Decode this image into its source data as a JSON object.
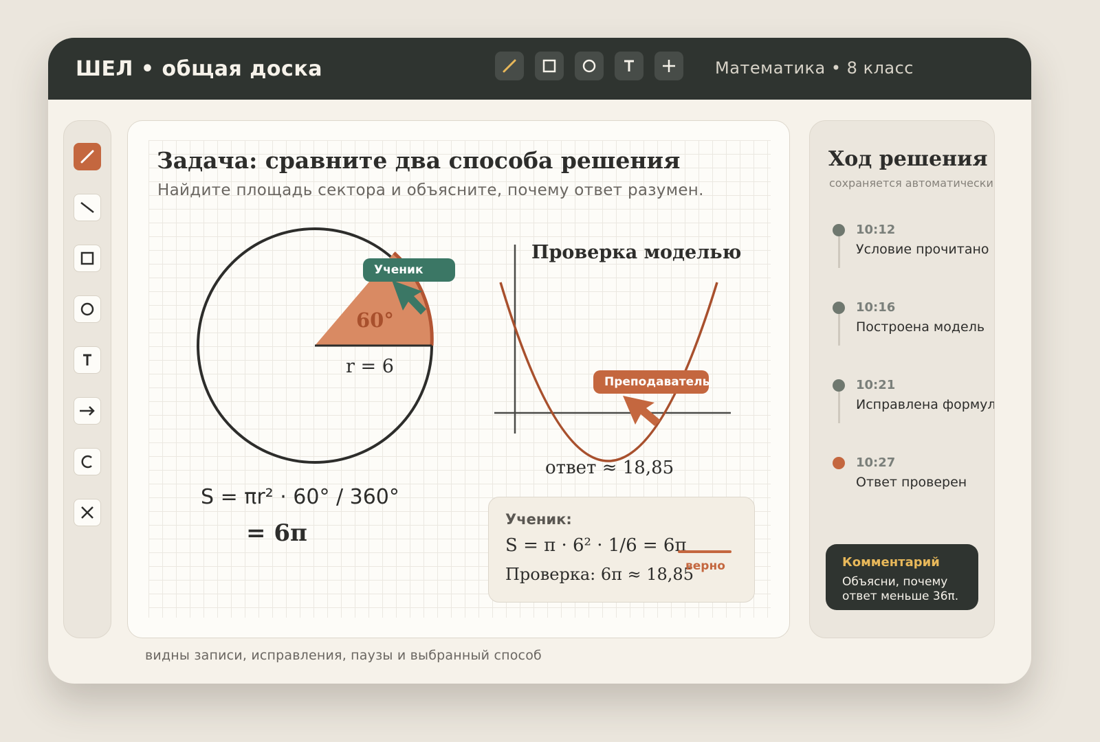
{
  "header": {
    "title": "ШЕЛ • общая доска",
    "subject": "Математика • 8 класс",
    "tools": [
      "pen-icon",
      "square-icon",
      "circle-icon",
      "text-icon",
      "plus-icon"
    ]
  },
  "left_tools": [
    "pen-icon",
    "line-icon",
    "square-icon",
    "circle-icon",
    "text-icon",
    "arrow-icon",
    "undo-icon",
    "close-icon"
  ],
  "board": {
    "title": "Задача: сравните два способа решения",
    "subtitle": "Найдите площадь сектора и объясните, почему ответ разумен.",
    "sector_angle_label": "60°",
    "radius_label": "r = 6",
    "student_tag": "Ученик",
    "model_title": "Проверка моделью",
    "teacher_tag": "Преподаватель",
    "answer_label": "ответ ≈ 18,85",
    "formula_line1": "S = πr² · 60° / 360°",
    "formula_line2": "= 6π",
    "solution": {
      "label": "Ученик:",
      "line1": "S = π · 6² · 1/6 = 6π",
      "line2": "Проверка: 6π ≈ 18,85",
      "mark": "верно"
    }
  },
  "timeline": {
    "title": "Ход решения",
    "subtitle": "сохраняется автоматически",
    "items": [
      {
        "time": "10:12",
        "text": "Условие прочитано",
        "color": "#6f786f"
      },
      {
        "time": "10:16",
        "text": "Построена модель",
        "color": "#6f786f"
      },
      {
        "time": "10:21",
        "text": "Исправлена формула",
        "color": "#6f786f"
      },
      {
        "time": "10:27",
        "text": "Ответ проверен",
        "color": "#c4673f"
      }
    ]
  },
  "comment": {
    "title": "Комментарий",
    "text": "Объясни, почему ответ меньше 36π."
  },
  "footer_note": "видны записи, исправления, паузы и выбранный способ",
  "colors": {
    "accent": "#c4673f",
    "student": "#3b7765",
    "dark": "#2f3430",
    "highlight": "#e8b85a"
  }
}
